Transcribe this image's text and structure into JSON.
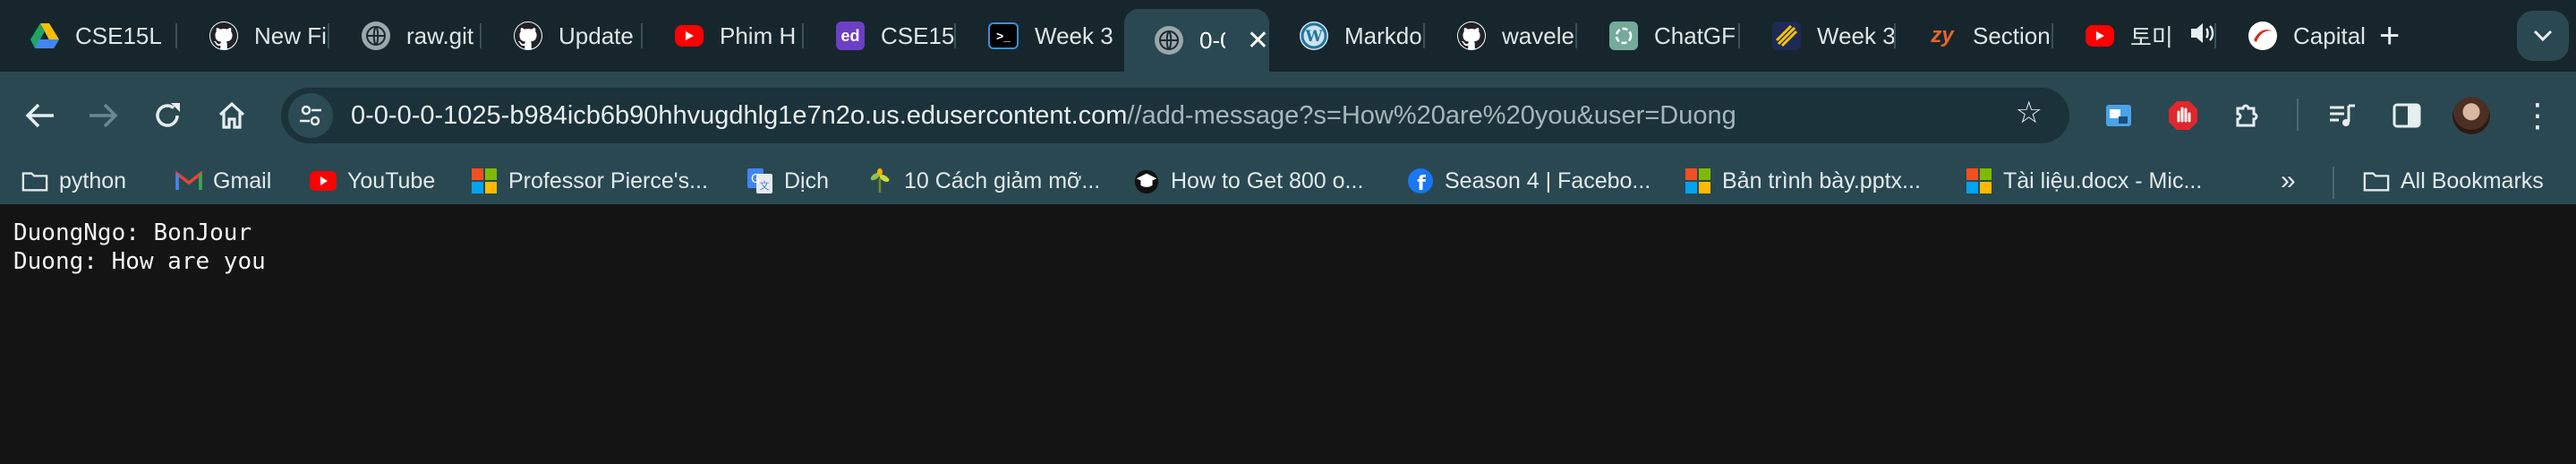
{
  "tabs": [
    {
      "title": "CSE15L",
      "icon": "google-drive-icon",
      "active": false
    },
    {
      "title": "New Fil",
      "icon": "github-icon",
      "active": false
    },
    {
      "title": "raw.git",
      "icon": "globe-icon",
      "active": false
    },
    {
      "title": "Update",
      "icon": "github-icon",
      "active": false
    },
    {
      "title": "Phim H",
      "icon": "youtube-icon",
      "active": false
    },
    {
      "title": "CSE15L",
      "icon": "edstem-icon",
      "active": false
    },
    {
      "title": "Week 3",
      "icon": "terminal-icon",
      "active": false
    },
    {
      "title": "0-0",
      "icon": "globe-icon",
      "active": true
    },
    {
      "title": "Markdo",
      "icon": "wordpress-icon",
      "active": false
    },
    {
      "title": "wavele",
      "icon": "github-icon",
      "active": false
    },
    {
      "title": "ChatGF",
      "icon": "chatgpt-icon",
      "active": false
    },
    {
      "title": "Week 3",
      "icon": "stripes-icon",
      "active": false
    },
    {
      "title": "Section",
      "icon": "zybooks-icon",
      "active": false
    },
    {
      "title": "토미",
      "icon": "youtube-icon",
      "active": false
    },
    {
      "title": "Capital",
      "icon": "capitalone-icon",
      "active": false
    }
  ],
  "address_bar": {
    "host": "0-0-0-0-1025-b984icb6b90hhvugdhlg1e7n2o.us.edusercontent.com",
    "path": "//add-message?s=How%20are%20you&user=Duong"
  },
  "bookmarks": [
    {
      "label": "python",
      "icon": "folder-icon"
    },
    {
      "label": "Gmail",
      "icon": "gmail-icon"
    },
    {
      "label": "YouTube",
      "icon": "youtube-icon"
    },
    {
      "label": "Professor Pierce's...",
      "icon": "microsoft-icon"
    },
    {
      "label": "Dịch",
      "icon": "google-translate-icon"
    },
    {
      "label": "10 Cách giảm mỡ...",
      "icon": "plant-icon"
    },
    {
      "label": "How to Get 800 o...",
      "icon": "graduation-cap-icon"
    },
    {
      "label": "Season 4 | Facebo...",
      "icon": "facebook-icon"
    },
    {
      "label": "Bản trình bày.pptx...",
      "icon": "microsoft-icon"
    },
    {
      "label": "Tài liệu.docx - Mic...",
      "icon": "microsoft-icon"
    }
  ],
  "bookmarks_overflow": "»",
  "all_bookmarks": "All Bookmarks",
  "messages": [
    "DuongNgo: BonJour",
    "Duong: How are you"
  ],
  "colors": {
    "tabstrip_bg": "#16262c",
    "toolbar_bg": "#2a4851",
    "page_bg": "#141414",
    "page_text": "#f2f2f2"
  }
}
